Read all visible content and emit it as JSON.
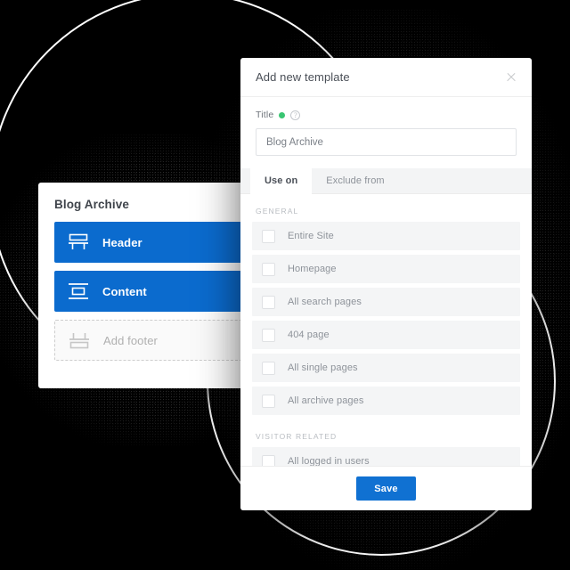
{
  "background": {
    "color": "#000000",
    "circle_stroke": "#ffffff",
    "circles": [
      "large-ring",
      "small-ring"
    ]
  },
  "left_card": {
    "title": "Blog Archive",
    "sections": [
      {
        "label": "Header",
        "icon": "header-layout-icon",
        "state": "filled",
        "menu_icon": "kebab-menu-icon"
      },
      {
        "label": "Content",
        "icon": "content-layout-icon",
        "state": "filled",
        "menu_icon": "kebab-menu-icon"
      },
      {
        "label": "Add footer",
        "icon": "footer-layout-icon",
        "state": "empty",
        "menu_icon": ""
      }
    ],
    "accent_color": "#0b6bce"
  },
  "modal": {
    "title": "Add new template",
    "close_icon": "close-icon",
    "title_field": {
      "label": "Title",
      "required_marker": "required-dot",
      "required_color": "#39c572",
      "help_icon": "help-icon",
      "help_glyph": "?",
      "value": "Blog Archive",
      "placeholder": "Blog Archive"
    },
    "tabs": [
      {
        "label": "Use on",
        "active": true
      },
      {
        "label": "Exclude from",
        "active": false
      }
    ],
    "groups": [
      {
        "label": "GENERAL",
        "options": [
          {
            "label": "Entire Site",
            "checked": false
          },
          {
            "label": "Homepage",
            "checked": false
          },
          {
            "label": "All search pages",
            "checked": false
          },
          {
            "label": "404 page",
            "checked": false
          },
          {
            "label": "All single pages",
            "checked": false
          },
          {
            "label": "All archive pages",
            "checked": false
          }
        ]
      },
      {
        "label": "VISITOR RELATED",
        "options": [
          {
            "label": "All logged in users",
            "checked": false
          }
        ]
      }
    ],
    "footer": {
      "save_label": "Save",
      "save_color": "#1071d2"
    }
  }
}
